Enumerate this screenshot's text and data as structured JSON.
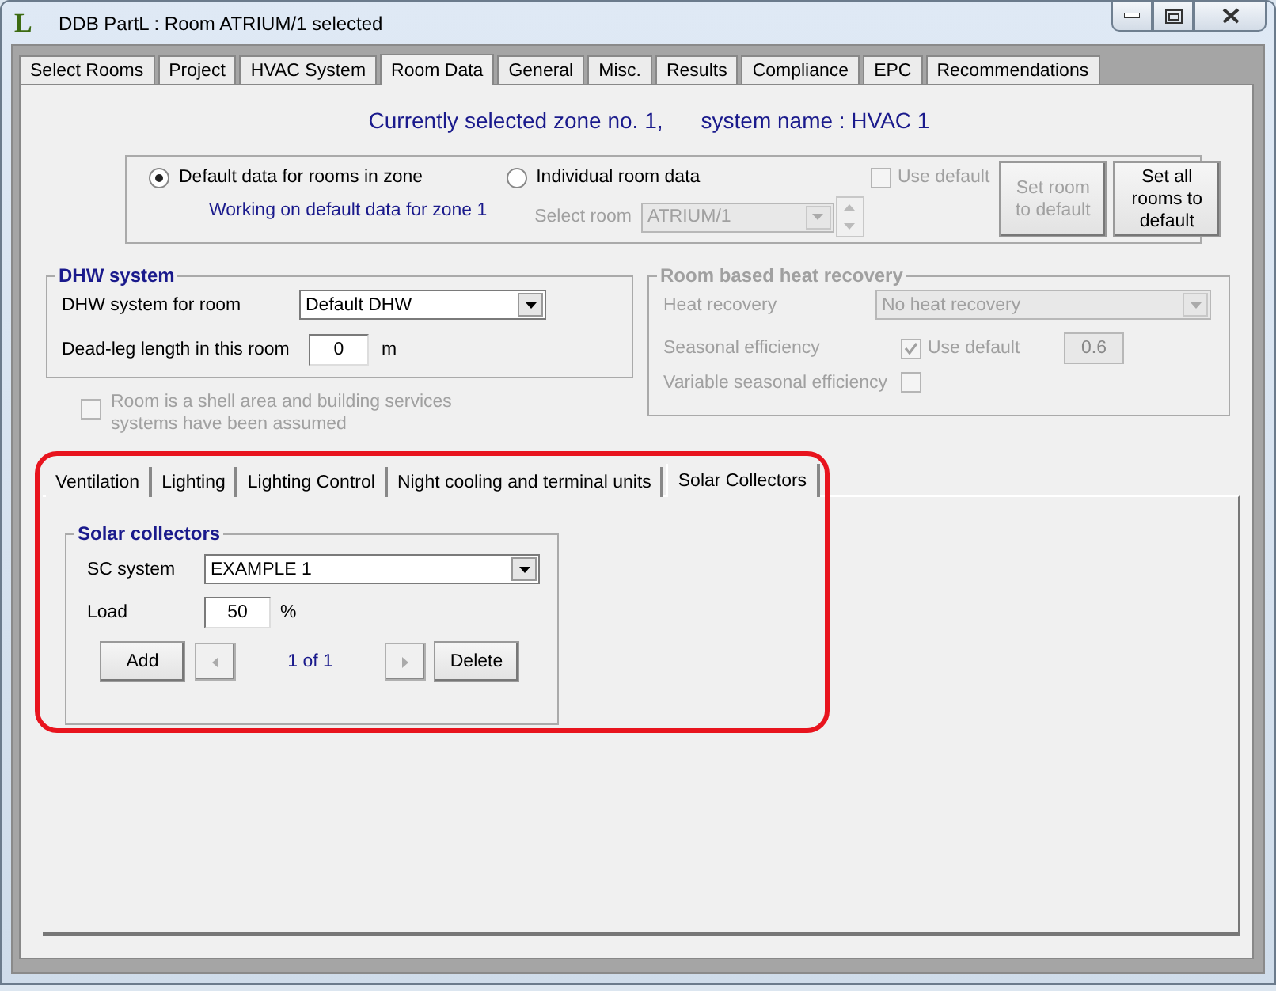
{
  "window": {
    "logo": "L",
    "title": "DDB PartL : Room ATRIUM/1 selected"
  },
  "tabs": [
    {
      "label": "Select Rooms",
      "selected": false
    },
    {
      "label": "Project",
      "selected": false
    },
    {
      "label": "HVAC System",
      "selected": false
    },
    {
      "label": "Room Data",
      "selected": true
    },
    {
      "label": "General",
      "selected": false
    },
    {
      "label": "Misc.",
      "selected": false
    },
    {
      "label": "Results",
      "selected": false
    },
    {
      "label": "Compliance",
      "selected": false
    },
    {
      "label": "EPC",
      "selected": false
    },
    {
      "label": "Recommendations",
      "selected": false
    }
  ],
  "header": {
    "zone": "Currently selected  zone no. 1,",
    "system": "system name : HVAC 1"
  },
  "room_mode": {
    "options": [
      {
        "label": "Default data for rooms in zone",
        "selected": true
      },
      {
        "label": "Individual room data",
        "selected": false
      }
    ],
    "note": "Working on default data for zone 1",
    "use_default": {
      "label": "Use default",
      "checked": false,
      "disabled": true
    },
    "select_room": {
      "label": "Select room",
      "value": "ATRIUM/1",
      "disabled": true
    },
    "buttons": [
      {
        "label": "Set room to default",
        "disabled": true
      },
      {
        "label": "Set all rooms to default",
        "disabled": false
      }
    ]
  },
  "dhw": {
    "title": "DHW system",
    "system_label": "DHW system for room",
    "system_value": "Default DHW",
    "deadleg_label": "Dead-leg length in this room",
    "deadleg_value": "0",
    "unit": "m"
  },
  "shell": {
    "label": "Room is a shell area and building services systems have been assumed",
    "checked": false,
    "disabled": true
  },
  "heat_recovery": {
    "title": "Room based heat recovery",
    "disabled": true,
    "recovery_label": "Heat recovery",
    "recovery_value": "No heat recovery",
    "efficiency_label": "Seasonal efficiency",
    "use_default": {
      "label": "Use default",
      "checked": true
    },
    "efficiency_value": "0.6",
    "variable_label": "Variable seasonal efficiency",
    "variable_checked": false
  },
  "subtabs": [
    {
      "label": "Ventilation",
      "selected": false
    },
    {
      "label": "Lighting",
      "selected": false
    },
    {
      "label": "Lighting Control",
      "selected": false
    },
    {
      "label": "Night cooling and terminal units",
      "selected": false
    },
    {
      "label": "Solar Collectors",
      "selected": true
    }
  ],
  "solar": {
    "title": "Solar collectors",
    "system_label": "SC system",
    "system_value": "EXAMPLE 1",
    "load_label": "Load",
    "load_value": "50",
    "unit": "%",
    "add": "Add",
    "pager": "1 of 1",
    "delete": "Delete"
  }
}
